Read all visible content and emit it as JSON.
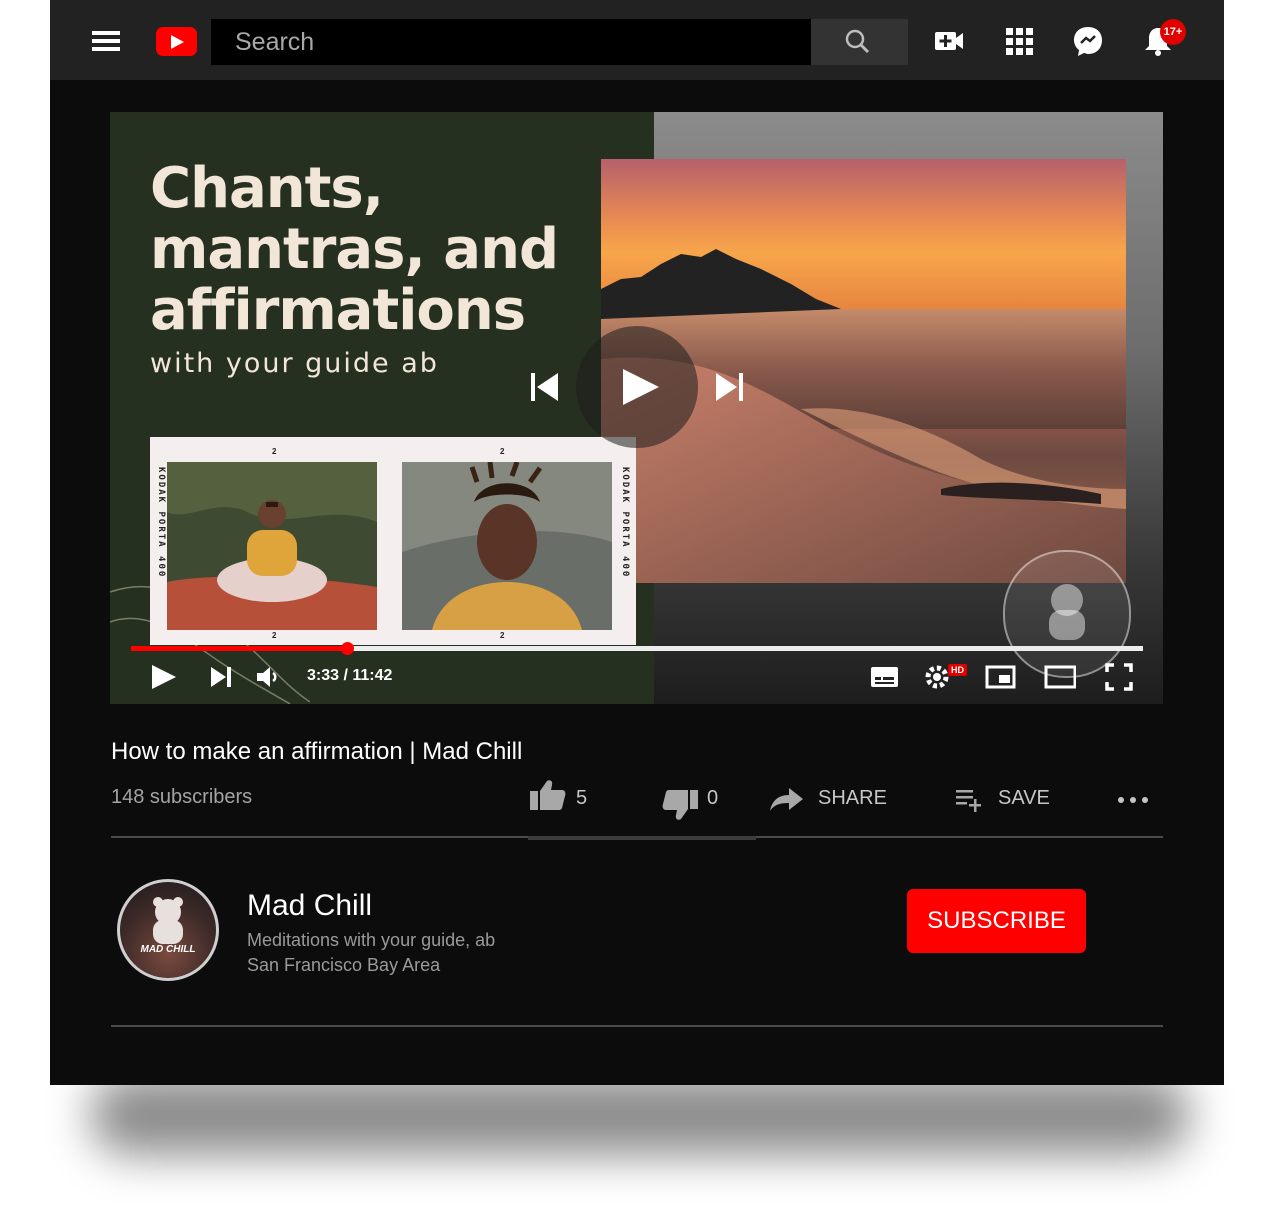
{
  "header": {
    "search_placeholder": "Search",
    "notification_badge": "17+"
  },
  "player": {
    "thumbnail": {
      "title": "Chants,\nmantras, and\naffirmations",
      "subtitle": "with your guide ab",
      "film_label": "KODAK PORTA 400",
      "frame_number": "2",
      "watermark_text": "MAD CHILL"
    },
    "time_display": "3:33 / 11:42",
    "progress_fraction": 0.213,
    "hd_label": "HD"
  },
  "video": {
    "title": "How to make an affirmation | Mad Chill",
    "subscribers": "148 subscribers",
    "likes": "5",
    "dislikes": "0",
    "share_label": "SHARE",
    "save_label": "SAVE"
  },
  "channel": {
    "name": "Mad Chill",
    "description": "Meditations with your guide, ab",
    "location": "San Francisco Bay Area",
    "avatar_text": "MAD CHILL",
    "subscribe_label": "SUBSCRIBE"
  },
  "colors": {
    "brand_red": "#ff0000",
    "header_bg": "#222222",
    "page_bg": "#0c0c0c"
  }
}
